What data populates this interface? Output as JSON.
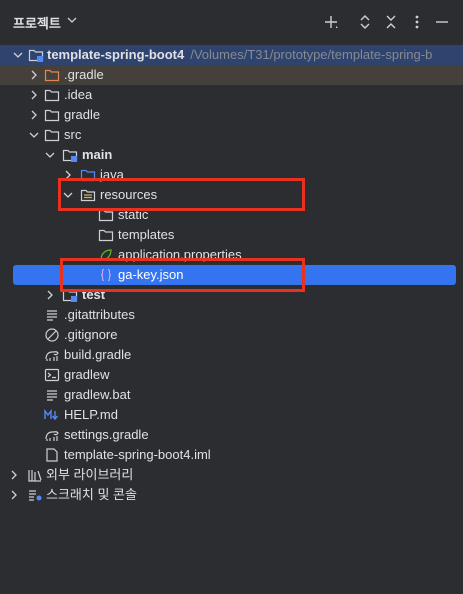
{
  "panel": {
    "title": "프로젝트"
  },
  "tree": {
    "root_label": "template-spring-boot4",
    "root_path": "/Volumes/T31/prototype/template-spring-b",
    "gradle_hidden": ".gradle",
    "idea": ".idea",
    "gradle": "gradle",
    "src": "src",
    "main": "main",
    "java": "java",
    "resources": "resources",
    "static": "static",
    "templates": "templates",
    "app_props": "application.properties",
    "ga_key": "ga-key.json",
    "test": "test",
    "gitattributes": ".gitattributes",
    "gitignore": ".gitignore",
    "build_gradle": "build.gradle",
    "gradlew": "gradlew",
    "gradlew_bat": "gradlew.bat",
    "help_md": "HELP.md",
    "settings_gradle": "settings.gradle",
    "iml": "template-spring-boot4.iml",
    "external_libs": "외부 라이브러리",
    "scratches": "스크래치 및 콘솔"
  },
  "colors": {
    "background": "#2b2d30",
    "selection": "#3574f0",
    "highlight_box": "#e8311e",
    "folder_stroke": "#ced0d6",
    "excluded_folder": "#e08855",
    "source_blue": "#548af7"
  }
}
